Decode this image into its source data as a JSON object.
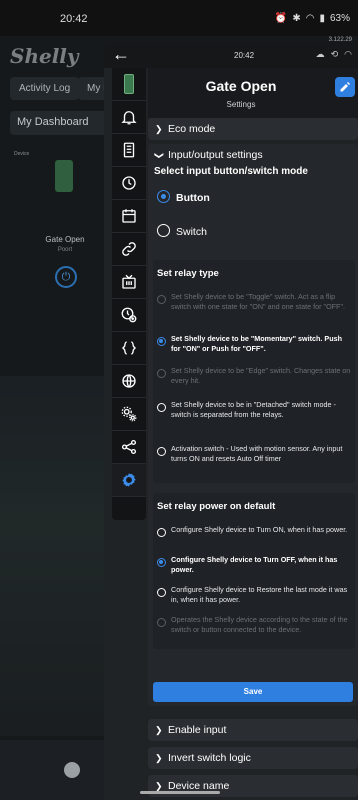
{
  "device_status": {
    "time": "20:42",
    "battery": "63%",
    "version": "3.122.29"
  },
  "background": {
    "logo": "Shelly",
    "tabs": [
      "Activity Log",
      "My D"
    ],
    "dashboard_label": "My Dashboard",
    "device_section": "Device",
    "device_name": "Gate Open",
    "device_room": "Poort"
  },
  "overlay_status": {
    "time": "20:42"
  },
  "header": {
    "title": "Gate Open",
    "subtitle": "Settings"
  },
  "sections": {
    "eco_mode": "Eco mode",
    "io_settings": "Input/output settings",
    "enable_input": "Enable input",
    "invert_switch": "Invert switch logic",
    "device_name": "Device name"
  },
  "input_mode": {
    "title": "Select input button/switch mode",
    "options": [
      "Button",
      "Switch"
    ],
    "selected": "Button"
  },
  "relay_type": {
    "title": "Set relay type",
    "options": [
      "Set Shelly device to be \"Toggle\" switch. Act as a flip switch with one state for \"ON\" and one state for \"OFF\".",
      "Set Shelly device to be \"Momentary\" switch. Push for \"ON\" or Push for \"OFF\".",
      "Set Shelly device to be \"Edge\" switch. Changes state on every hit.",
      "Set Shelly device to be in \"Detached\" switch mode - switch is separated from the relays.",
      "Activation switch - Used with motion sensor. Any input turns ON and resets Auto Off timer"
    ]
  },
  "power_default": {
    "title": "Set relay power on default",
    "options": [
      "Configure Shelly device to Turn ON, when it has power.",
      "Configure Shelly device to Turn OFF, when it has power.",
      "Configure Shelly device to Restore the last mode it was in, when it has power.",
      "Operates the Shelly device according to the state of the switch or button connected to the device."
    ]
  },
  "save_label": "Save",
  "colors": {
    "accent": "#2f7fe0",
    "panel": "#202326",
    "card": "#1f2226"
  }
}
